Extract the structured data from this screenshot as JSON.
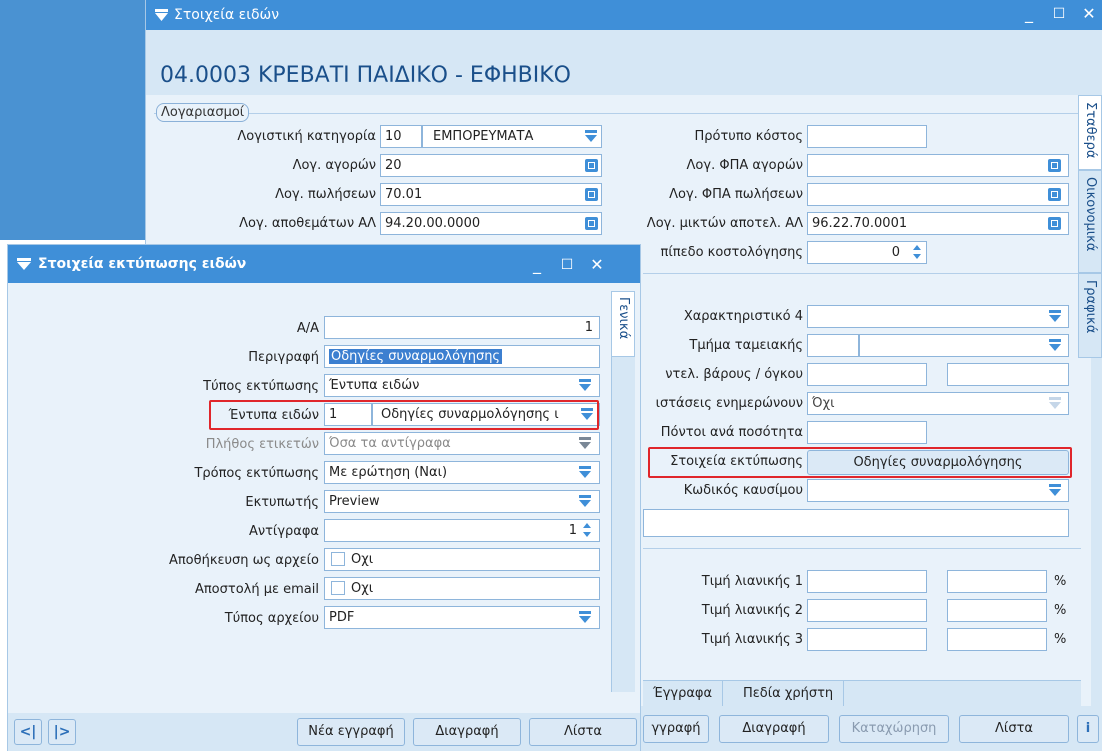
{
  "back_window": {
    "title": "Στοιχεία ειδών",
    "item_header": "04.0003 ΚΡΕΒΑΤΙ ΠΑΙΔΙΚΟ - ΕΦΗΒΙΚΟ",
    "group_label": "Λογαριασμοί",
    "fields_left": [
      {
        "label": "Λογιστική κατηγορία",
        "code": "10",
        "value": "ΕΜΠΟΡΕΥΜΑΤΑ"
      },
      {
        "label": "Λογ. αγορών",
        "value": "20"
      },
      {
        "label": "Λογ. πωλήσεων",
        "value": "70.01"
      },
      {
        "label": "Λογ. αποθεμάτων ΑΛ",
        "value": "94.20.00.0000"
      }
    ],
    "fields_right_top": [
      {
        "label": "Πρότυπο κόστος",
        "value": ""
      },
      {
        "label": "Λογ. ΦΠΑ αγορών",
        "value": ""
      },
      {
        "label": "Λογ. ΦΠΑ πωλήσεων",
        "value": ""
      },
      {
        "label": "Λογ. μικτών αποτελ. ΑΛ",
        "value": "96.22.70.0001"
      },
      {
        "label": "πίπεδο κοστολόγησης",
        "value": "0"
      }
    ],
    "fields_right_mid": [
      {
        "label": "Χαρακτηριστικό 4",
        "value": ""
      },
      {
        "label": "Τμήμα ταμειακής",
        "value": ""
      },
      {
        "label": "ντελ. βάρους / όγκου",
        "value": ""
      },
      {
        "label": "ιστάσεις ενημερώνουν",
        "value": "Όχι"
      },
      {
        "label": "Πόντοι ανά ποσότητα",
        "value": ""
      },
      {
        "label": "Στοιχεία εκτύπωσης",
        "value": "Οδηγίες συναρμολόγησης"
      },
      {
        "label": "Κωδικός καυσίμου",
        "value": ""
      }
    ],
    "price_fields": [
      {
        "label": "Τιμή λιανικής 1",
        "unit": "%"
      },
      {
        "label": "Τιμή λιανικής 2",
        "unit": "%"
      },
      {
        "label": "Τιμή λιανικής 3",
        "unit": "%"
      }
    ],
    "vertical_tabs": [
      "Σταθερά",
      "Οικονομικά",
      "Γραφικά"
    ],
    "bottom_tabs": [
      "Έγγραφα",
      "Πεδία χρήστη"
    ],
    "buttons": [
      "γγραφή",
      "Διαγραφή",
      "Καταχώρηση",
      "Λίστα"
    ]
  },
  "print_dialog": {
    "title": "Στοιχεία εκτύπωσης ειδών",
    "tab": "Γενικά",
    "fields": {
      "aa": {
        "label": "Α/Α",
        "value": "1"
      },
      "description": {
        "label": "Περιγραφή",
        "value": "Οδηγίες συναρμολόγησης"
      },
      "print_type": {
        "label": "Τύπος εκτύπωσης",
        "value": "Έντυπα ειδών"
      },
      "forms": {
        "label": "Έντυπα ειδών",
        "code": "1",
        "value": "Οδηγίες συναρμολόγησης ι"
      },
      "labels_count": {
        "label": "Πλήθος ετικετών",
        "value": "Όσα τα αντίγραφα"
      },
      "print_mode": {
        "label": "Τρόπος εκτύπωσης",
        "value": "Με ερώτηση (Ναι)"
      },
      "printer": {
        "label": "Εκτυπωτής",
        "value": "Preview"
      },
      "copies": {
        "label": "Αντίγραφα",
        "value": "1"
      },
      "save_file": {
        "label": "Αποθήκευση ως αρχείο",
        "value": "Οχι"
      },
      "send_email": {
        "label": "Αποστολή με email",
        "value": "Οχι"
      },
      "file_type": {
        "label": "Τύπος αρχείου",
        "value": "PDF"
      }
    },
    "nav": {
      "prev": "<|",
      "next": "|>"
    },
    "buttons": {
      "new": "Νέα εγγραφή",
      "delete": "Διαγραφή",
      "list": "Λίστα"
    }
  },
  "colors": {
    "title_bar": "#3f8fd8",
    "highlight": "#e0262b",
    "panel_bg": "#e9f2fa"
  }
}
